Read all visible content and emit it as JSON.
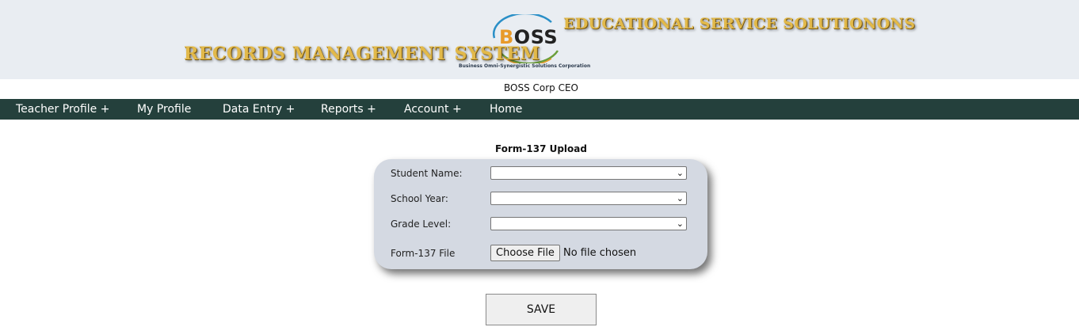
{
  "banner": {
    "title": "RECORDS MANAGEMENT SYSTEM",
    "subtitle": "EDUCATIONAL SERVICE SOLUTIONONS",
    "logo_text": "BOSS",
    "logo_caption": "Business Omni-Synergistic Solutions Corporation"
  },
  "user": {
    "name": "BOSS Corp CEO"
  },
  "nav": {
    "items": [
      {
        "label": "Teacher Profile +"
      },
      {
        "label": "My Profile"
      },
      {
        "label": "Data Entry +"
      },
      {
        "label": "Reports +"
      },
      {
        "label": "Account +"
      },
      {
        "label": "Home"
      }
    ]
  },
  "form": {
    "title": "Form-137 Upload",
    "fields": [
      {
        "label": "Student Name:",
        "value": ""
      },
      {
        "label": "School Year:",
        "value": ""
      },
      {
        "label": "Grade Level:",
        "value": ""
      }
    ],
    "file_field": {
      "label": "Form-137 File",
      "button_label": "Choose File",
      "status": "No file chosen"
    },
    "save_label": "SAVE"
  },
  "colors": {
    "banner_bg": "#e9edf2",
    "nav_bg": "#24403c",
    "banner_text": "#e2b94a",
    "panel_bg": "#d4d9e2"
  }
}
